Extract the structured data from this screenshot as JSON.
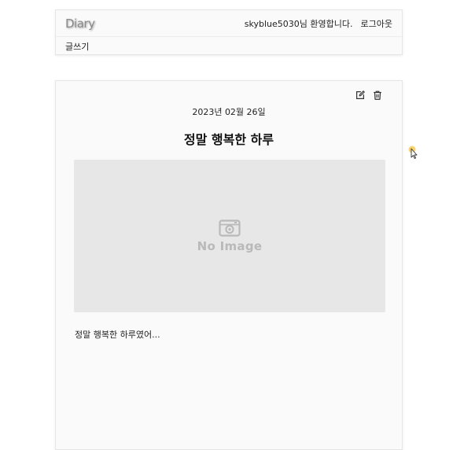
{
  "header": {
    "logo": "Diary",
    "welcome": "skyblue5030님 환영합니다.",
    "logout_label": "로그아웃",
    "write_label": "글쓰기"
  },
  "post": {
    "date": "2023년 02월 26일",
    "title": "정말 행복한 하루",
    "image_placeholder": "No Image",
    "body": "정말 행복한 하루였어..."
  },
  "icons": {
    "edit": "edit-icon",
    "delete": "trash-icon",
    "no_image": "camera-icon"
  },
  "colors": {
    "card_bg": "#fafafa",
    "image_bg": "#e7e7e8",
    "cursor_highlight": "#f5c242"
  }
}
